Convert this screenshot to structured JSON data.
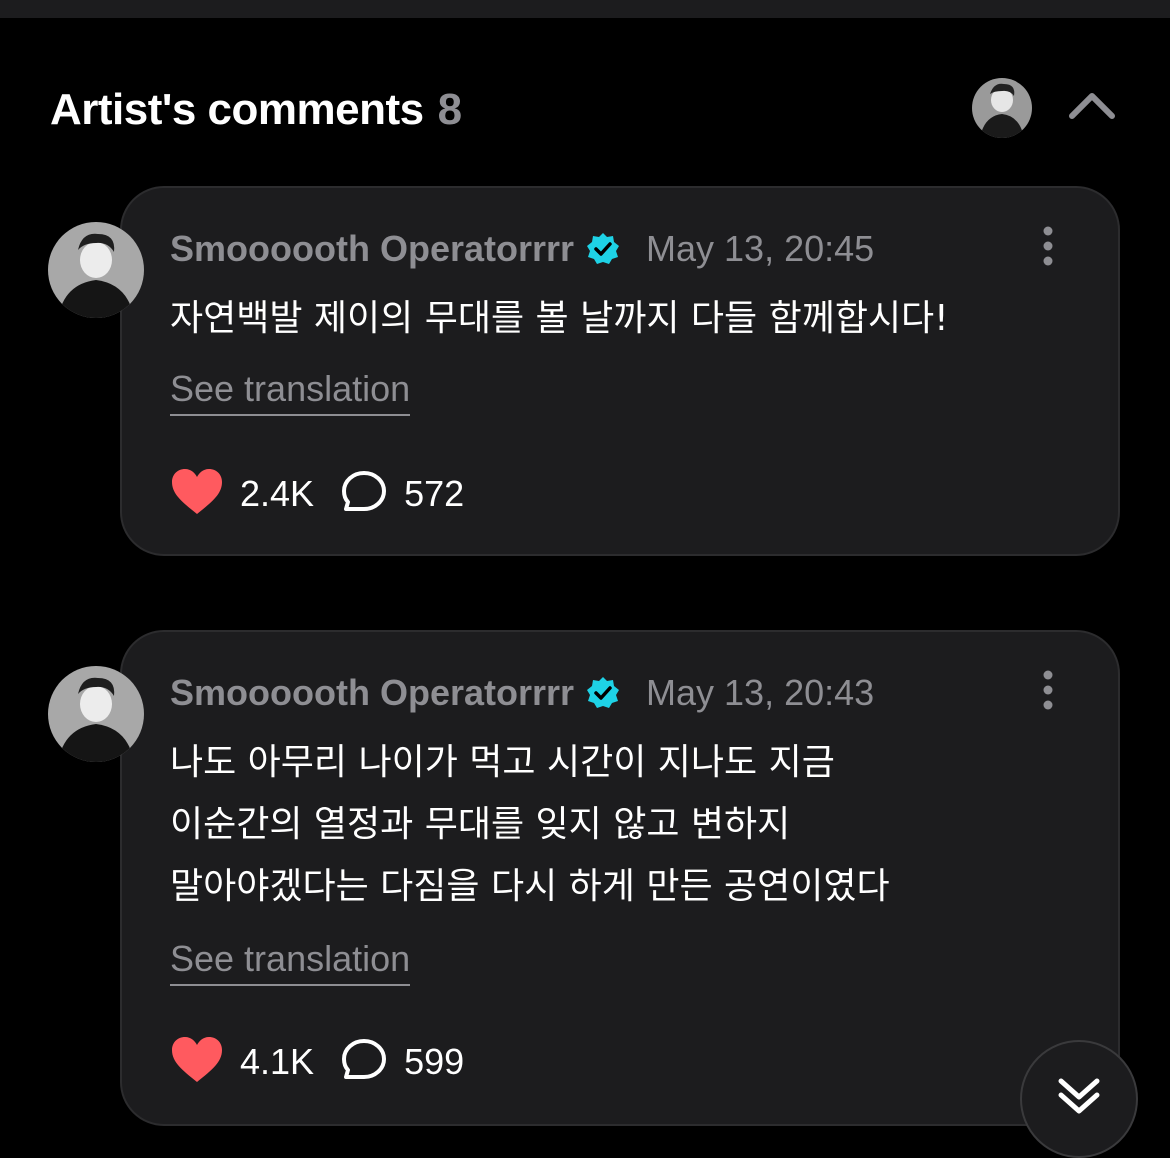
{
  "header": {
    "title": "Artist's comments",
    "count": "8"
  },
  "comments": [
    {
      "author": "Smoooooth Operatorrrr",
      "time": "May 13, 20:45",
      "text": "자연백발 제이의 무대를 볼 날까지 다들 함께합시다!",
      "see_translation": "See translation",
      "likes": "2.4K",
      "replies": "572"
    },
    {
      "author": "Smoooooth Operatorrrr",
      "time": "May 13, 20:43",
      "text": "나도 아무리 나이가 먹고 시간이 지나도 지금\n이순간의 열정과 무대를 잊지 않고 변하지\n말아야겠다는 다짐을 다시 하게 만든 공연이였다",
      "see_translation": "See translation",
      "likes": "4.1K",
      "replies": "599"
    }
  ],
  "icons": {
    "header_avatar": "avatar-icon",
    "collapse": "chevron-up-icon",
    "verified": "verified-badge-icon",
    "more": "more-vertical-icon",
    "like": "heart-icon",
    "reply": "comment-bubble-icon",
    "scroll_down": "double-chevron-down-icon"
  },
  "colors": {
    "background": "#000000",
    "card": "#1c1c1e",
    "muted": "#8e8e93",
    "verified": "#1ed2e6",
    "heart": "#ff5a5f"
  }
}
